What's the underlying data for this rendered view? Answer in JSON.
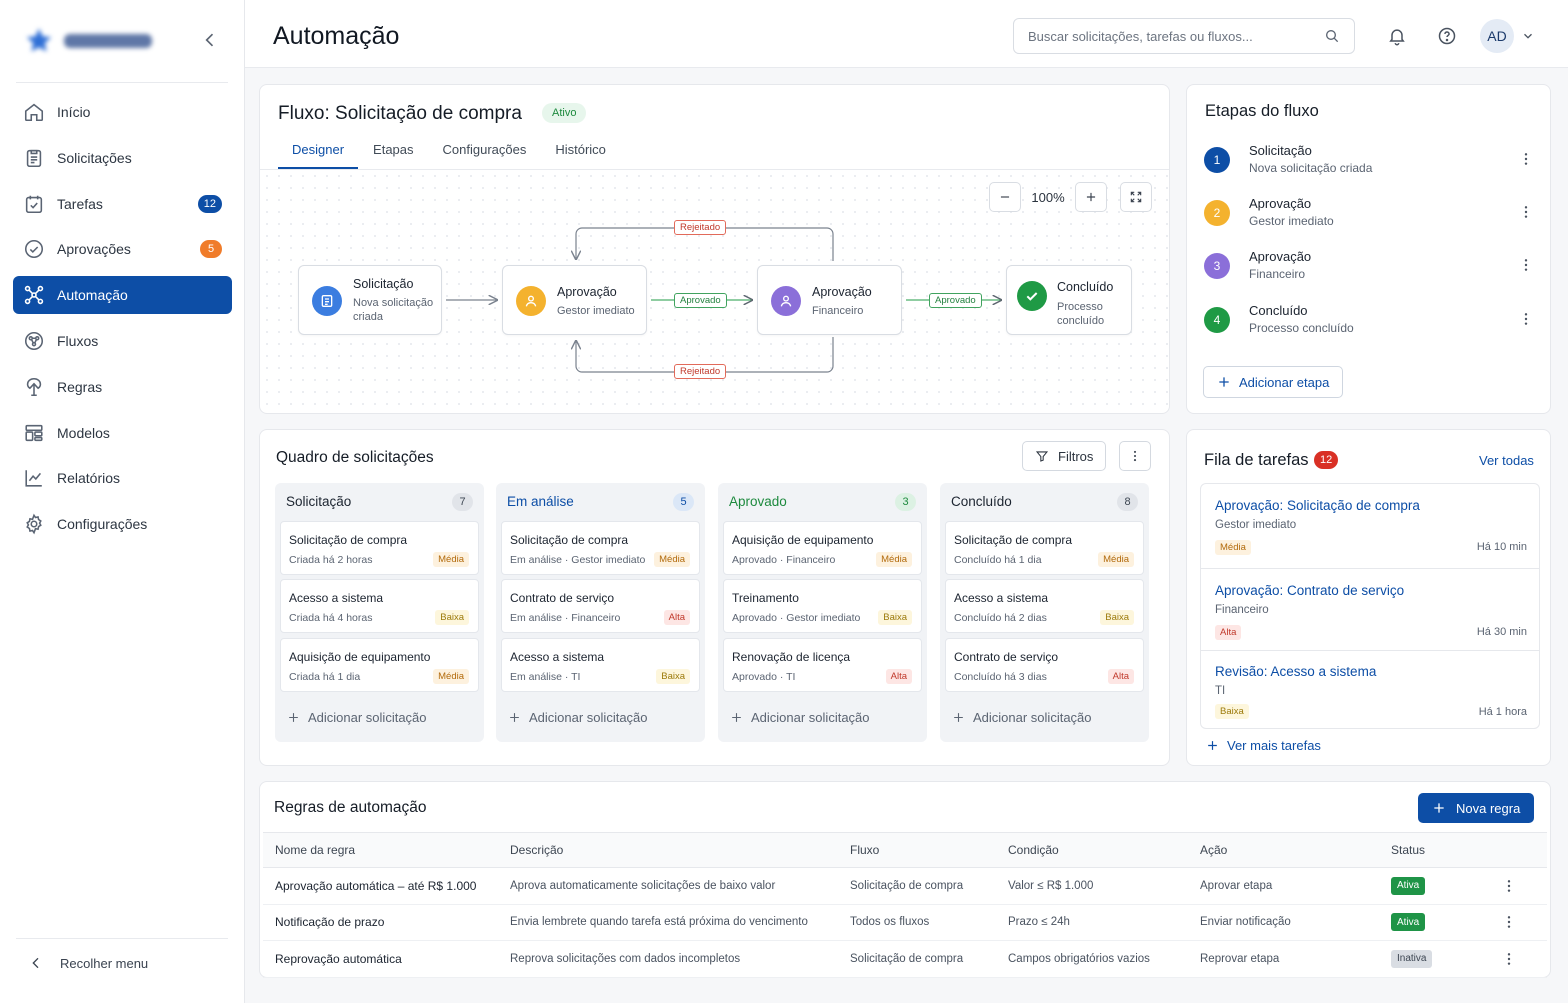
{
  "header": {
    "title": "Automação",
    "search_placeholder": "Buscar solicitações, tarefas ou fluxos...",
    "avatar": "AD"
  },
  "sidebar": {
    "items": [
      {
        "label": "Início",
        "icon": "home-icon"
      },
      {
        "label": "Solicitações",
        "icon": "clipboard-icon"
      },
      {
        "label": "Tarefas",
        "icon": "task-icon",
        "badge": "12",
        "badge_color": "#0d4ea6"
      },
      {
        "label": "Aprovações",
        "icon": "check-circle-icon",
        "badge": "5",
        "badge_color": "#f07c2a"
      },
      {
        "label": "Automação",
        "icon": "automation-icon",
        "active": true
      },
      {
        "label": "Fluxos",
        "icon": "flows-icon"
      },
      {
        "label": "Regras",
        "icon": "rules-icon"
      },
      {
        "label": "Modelos",
        "icon": "templates-icon"
      },
      {
        "label": "Relatórios",
        "icon": "chart-icon"
      },
      {
        "label": "Configurações",
        "icon": "gear-icon"
      }
    ],
    "collapse_label": "Recolher menu"
  },
  "flow": {
    "title": "Fluxo: Solicitação de compra",
    "status": "Ativo",
    "tabs": [
      "Designer",
      "Etapas",
      "Configurações",
      "Histórico"
    ],
    "active_tab": "Designer",
    "zoom": "100%",
    "nodes": [
      {
        "title": "Solicitação",
        "subtitle_1": "Nova solicitação",
        "subtitle_2": "criada",
        "color": "#3b7de0"
      },
      {
        "title": "Aprovação",
        "subtitle_1": "Gestor imediato",
        "color": "#f4b22e"
      },
      {
        "title": "Aprovação",
        "subtitle_1": "Financeiro",
        "color": "#8b6fd9"
      },
      {
        "title": "Concluído",
        "subtitle_1": "Processo",
        "subtitle_2": "concluído",
        "color": "#1f9a45"
      }
    ],
    "edge_labels": {
      "approved_1": "Aprovado",
      "approved_2": "Aprovado",
      "rejected_top": "Rejeitado",
      "rejected_bottom": "Rejeitado"
    }
  },
  "steps": {
    "title": "Etapas do fluxo",
    "items": [
      {
        "num": "1",
        "title": "Solicitação",
        "subtitle": "Nova solicitação criada",
        "color": "#0d4ea6"
      },
      {
        "num": "2",
        "title": "Aprovação",
        "subtitle": "Gestor imediato",
        "color": "#f4b22e"
      },
      {
        "num": "3",
        "title": "Aprovação",
        "subtitle": "Financeiro",
        "color": "#8b6fd9"
      },
      {
        "num": "4",
        "title": "Concluído",
        "subtitle": "Processo concluído",
        "color": "#1f9a45"
      }
    ],
    "add_label": "Adicionar etapa"
  },
  "board": {
    "title": "Quadro de solicitações",
    "filters_label": "Filtros",
    "add_label": "Adicionar solicitação",
    "columns": [
      {
        "title": "Solicitação",
        "count": "7",
        "title_color": "#1c2430",
        "count_bg": "#e1e4e9",
        "count_color": "#3d4652",
        "cards": [
          {
            "title": "Solicitação de compra",
            "sub": "Criada há 2 horas",
            "priority": "Média",
            "level": "media"
          },
          {
            "title": "Acesso a sistema",
            "sub": "Criada há 4 horas",
            "priority": "Baixa",
            "level": "baixa"
          },
          {
            "title": "Aquisição de equipamento",
            "sub": "Criada há 1 dia",
            "priority": "Média",
            "level": "media"
          }
        ]
      },
      {
        "title": "Em análise",
        "count": "5",
        "title_color": "#0d4ea6",
        "count_bg": "#dbe7f7",
        "count_color": "#0d4ea6",
        "cards": [
          {
            "title": "Solicitação de compra",
            "sub": "Em análise · Gestor imediato",
            "priority": "Média",
            "level": "media"
          },
          {
            "title": "Contrato de serviço",
            "sub": "Em análise · Financeiro",
            "priority": "Alta",
            "level": "alta"
          },
          {
            "title": "Acesso a sistema",
            "sub": "Em análise · TI",
            "priority": "Baixa",
            "level": "baixa"
          }
        ]
      },
      {
        "title": "Aprovado",
        "count": "3",
        "title_color": "#1d8a3e",
        "count_bg": "#dcf1e3",
        "count_color": "#1d8a3e",
        "cards": [
          {
            "title": "Aquisição de equipamento",
            "sub": "Aprovado · Financeiro",
            "priority": "Média",
            "level": "media"
          },
          {
            "title": "Treinamento",
            "sub": "Aprovado · Gestor imediato",
            "priority": "Baixa",
            "level": "baixa"
          },
          {
            "title": "Renovação de licença",
            "sub": "Aprovado · TI",
            "priority": "Alta",
            "level": "alta"
          }
        ]
      },
      {
        "title": "Concluído",
        "count": "8",
        "title_color": "#1c2430",
        "count_bg": "#e1e4e9",
        "count_color": "#3d4652",
        "cards": [
          {
            "title": "Solicitação de compra",
            "sub": "Concluído há 1 dia",
            "priority": "Média",
            "level": "media"
          },
          {
            "title": "Acesso a sistema",
            "sub": "Concluído há 2 dias",
            "priority": "Baixa",
            "level": "baixa"
          },
          {
            "title": "Contrato de serviço",
            "sub": "Concluído há 3 dias",
            "priority": "Alta",
            "level": "alta"
          }
        ]
      }
    ]
  },
  "tasks": {
    "title": "Fila de tarefas",
    "count": "12",
    "see_all": "Ver todas",
    "see_more": "Ver mais tarefas",
    "items": [
      {
        "title": "Aprovação: Solicitação de compra",
        "sub": "Gestor imediato",
        "priority": "Média",
        "level": "media",
        "time": "Há 10 min"
      },
      {
        "title": "Aprovação: Contrato de serviço",
        "sub": "Financeiro",
        "priority": "Alta",
        "level": "alta",
        "time": "Há 30 min"
      },
      {
        "title": "Revisão: Acesso a sistema",
        "sub": "TI",
        "priority": "Baixa",
        "level": "baixa",
        "time": "Há 1 hora"
      }
    ]
  },
  "rules": {
    "title": "Regras de automação",
    "new_label": "Nova regra",
    "columns": [
      "Nome da regra",
      "Descrição",
      "Fluxo",
      "Condição",
      "Ação",
      "Status"
    ],
    "rows": [
      {
        "name": "Aprovação automática – até R$ 1.000",
        "desc": "Aprova automaticamente solicitações de baixo valor",
        "flow": "Solicitação de compra",
        "cond": "Valor ≤ R$ 1.000",
        "action": "Aprovar etapa",
        "status": "Ativa",
        "state": "ativa"
      },
      {
        "name": "Notificação de prazo",
        "desc": "Envia lembrete quando tarefa está próxima do vencimento",
        "flow": "Todos os fluxos",
        "cond": "Prazo ≤ 24h",
        "action": "Enviar notificação",
        "status": "Ativa",
        "state": "ativa"
      },
      {
        "name": "Reprovação automática",
        "desc": "Reprova solicitações com dados incompletos",
        "flow": "Solicitação de compra",
        "cond": "Campos obrigatórios vazios",
        "action": "Reprovar etapa",
        "status": "Inativa",
        "state": "inativa"
      }
    ]
  }
}
